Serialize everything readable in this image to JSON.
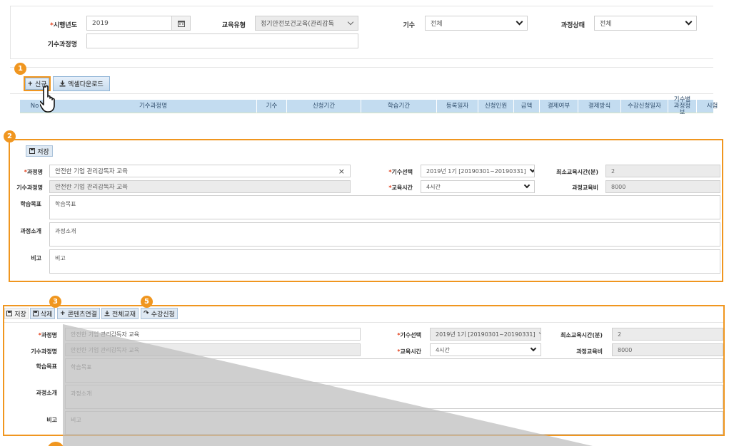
{
  "search": {
    "year_label": "시행년도",
    "year_value": "2019",
    "edu_type_label": "교육유형",
    "edu_type_value": "정기안전보건교육(관리감독",
    "term_label": "기수",
    "term_value": "전체",
    "status_label": "과정상태",
    "status_value": "전체",
    "term_course_label": "기수과정명",
    "term_course_value": ""
  },
  "toolbar": {
    "new_label": "신규",
    "excel_label": "엑셀다운로드"
  },
  "grid": {
    "columns": [
      "No",
      "기수과정명",
      "기수",
      "신청기간",
      "학습기간",
      "등록일자",
      "신청인원",
      "금액",
      "결제여부",
      "결제방식",
      "수강신청일자",
      "기수별 과정정보",
      "시험"
    ]
  },
  "form1": {
    "save_label": "저장",
    "course_label": "과정명",
    "course_value": "안전한 기업 관리감독자 교육",
    "clear_glyph": "×",
    "term_course_label": "기수과정명",
    "term_course_value": "안전한 기업 관리감독자 교육",
    "term_select_label": "기수선택",
    "term_select_value": "2019년 1기 [20190301~20190331]",
    "edu_time_label": "교육시간",
    "edu_time_value": "4시간",
    "min_time_label": "최소교육시간(분)",
    "min_time_value": "2",
    "fee_label": "과정교육비",
    "fee_value": "8000",
    "goal_label": "학습목표",
    "goal_value": "학습목표",
    "intro_label": "과정소개",
    "intro_value": "과정소개",
    "note_label": "비고",
    "note_value": "비고"
  },
  "form2": {
    "save_label": "저장",
    "delete_label": "삭제",
    "content_link_label": "콘텐츠연결",
    "all_material_label": "전체교재",
    "enroll_label": "수강신청",
    "course_label": "과정명",
    "course_value": "안전한 기업 관리감독자 교육",
    "term_course_label": "기수과정명",
    "term_course_value": "안전한 기업 관리감독자 교육",
    "term_select_label": "기수선택",
    "term_select_value": "2019년 1기 [20190301~20190331]",
    "edu_time_label": "교육시간",
    "edu_time_value": "4시간",
    "min_time_label": "최소교육시간(분)",
    "min_time_value": "2",
    "fee_label": "과정교육비",
    "fee_value": "8000",
    "goal_label": "학습목표",
    "goal_value": "학습목표",
    "intro_label": "과정소개",
    "intro_value": "과정소개",
    "note_label": "비고",
    "note_value": "비고"
  },
  "markers": {
    "m1": "1",
    "m2": "2",
    "m3": "3",
    "m5": "5"
  },
  "colors": {
    "accent_orange": "#f0961f",
    "required_red": "#e2401c",
    "grid_header_blue": "#c3dcf0"
  }
}
